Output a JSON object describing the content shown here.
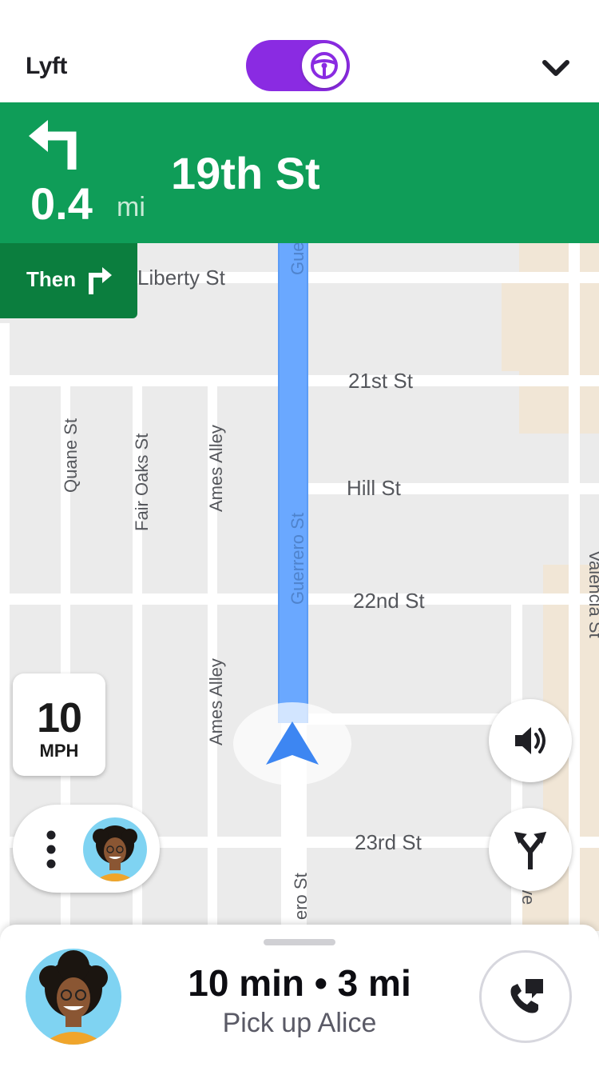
{
  "topbar": {
    "app_name": "Lyft",
    "driver_mode_toggle": "on",
    "toggle_icon": "steering-wheel-icon",
    "menu_icon": "chevron-down-icon"
  },
  "navigation": {
    "turn_icon": "turn-left-arrow-icon",
    "distance": "0.4",
    "unit": "mi",
    "street": "19th St",
    "then_label": "Then",
    "then_icon": "turn-right-arrow-icon"
  },
  "map": {
    "streets": {
      "liberty": "Liberty St",
      "st21": "21st St",
      "hill": "Hill St",
      "st22": "22nd St",
      "st23": "23rd St",
      "quane": "Quane St",
      "fair_oaks": "Fair Oaks St",
      "ames_upper": "Ames Alley",
      "ames_lower": "Ames Alley",
      "guerrero": "Guerrero St",
      "guerrero_top": "Gue",
      "guerrero_bottom": "ero St",
      "valencia": "Valencia St",
      "san_jose": "n Jose Ave"
    },
    "colors": {
      "route": "#5b9cf6",
      "road": "#ffffff",
      "land": "#ebebeb",
      "building": "#f1e6d6",
      "nav_green": "#0f9d58",
      "accent_purple": "#8a2be2"
    }
  },
  "speed": {
    "value": "10",
    "unit": "MPH"
  },
  "controls": {
    "more_icon": "more-vertical-icon",
    "sound_icon": "volume-icon",
    "route_icon": "fork-route-icon"
  },
  "trip": {
    "eta": "10 min • 3 mi",
    "action": "Pick up Alice",
    "call_icon": "phone-chat-icon"
  }
}
